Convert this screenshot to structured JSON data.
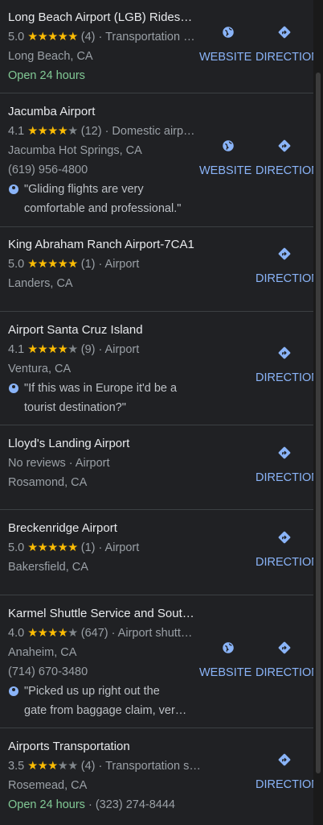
{
  "results": [
    {
      "title": "Long Beach Airport (LGB) Rides…",
      "rating": "5.0",
      "stars": "★★★★★",
      "stars_empty": "",
      "reviews": "(4)",
      "category": "· Transportation …",
      "address": "Long Beach, CA",
      "status": "Open 24 hours",
      "website_label": "WEBSITE",
      "directions_label": "DIRECTIONS"
    },
    {
      "title": "Jacumba Airport",
      "rating": "4.1",
      "stars": "★★★★",
      "stars_empty": "★",
      "reviews": "(12)",
      "category": "· Domestic airp…",
      "address": "Jacumba Hot Springs, CA",
      "phone": "(619) 956-4800",
      "review_text": "\"Gliding flights are very comfortable and professional.\"",
      "website_label": "WEBSITE",
      "directions_label": "DIRECTIONS"
    },
    {
      "title": "King Abraham Ranch Airport-7CA1",
      "rating": "5.0",
      "stars": "★★★★★",
      "stars_empty": "",
      "reviews": "(1)",
      "category": "· Airport",
      "address": "Landers, CA",
      "directions_label": "DIRECTIONS"
    },
    {
      "title": "Airport Santa Cruz Island",
      "rating": "4.1",
      "stars": "★★★★",
      "stars_empty": "★",
      "reviews": "(9)",
      "category": "· Airport",
      "address": "Ventura, CA",
      "review_text": "\"If this was in Europe it'd be a tourist destination?\"",
      "directions_label": "DIRECTIONS"
    },
    {
      "title": "Lloyd's Landing Airport",
      "no_reviews": "No reviews · Airport",
      "address": "Rosamond, CA",
      "directions_label": "DIRECTIONS"
    },
    {
      "title": "Breckenridge Airport",
      "rating": "5.0",
      "stars": "★★★★★",
      "stars_empty": "",
      "reviews": "(1)",
      "category": "· Airport",
      "address": "Bakersfield, CA",
      "directions_label": "DIRECTIONS"
    },
    {
      "title": "Karmel Shuttle Service and Sout…",
      "rating": "4.0",
      "stars": "★★★★",
      "stars_empty": "★",
      "reviews": "(647)",
      "category": "· Airport shutt…",
      "address": "Anaheim, CA",
      "phone": "(714) 670-3480",
      "review_line1": "\"Picked us up right out the",
      "review_line2": "gate from baggage claim, ver…",
      "website_label": "WEBSITE",
      "directions_label": "DIRECTIONS"
    },
    {
      "title": "Airports Transportation",
      "rating": "3.5",
      "stars": "★★★",
      "stars_empty": "★★",
      "reviews": "(4)",
      "category": "· Transportation service",
      "address": "Rosemead, CA",
      "status": "Open 24 hours",
      "status_extra": " · (323) 274-8444",
      "directions_label": "DIRECTIONS"
    }
  ]
}
